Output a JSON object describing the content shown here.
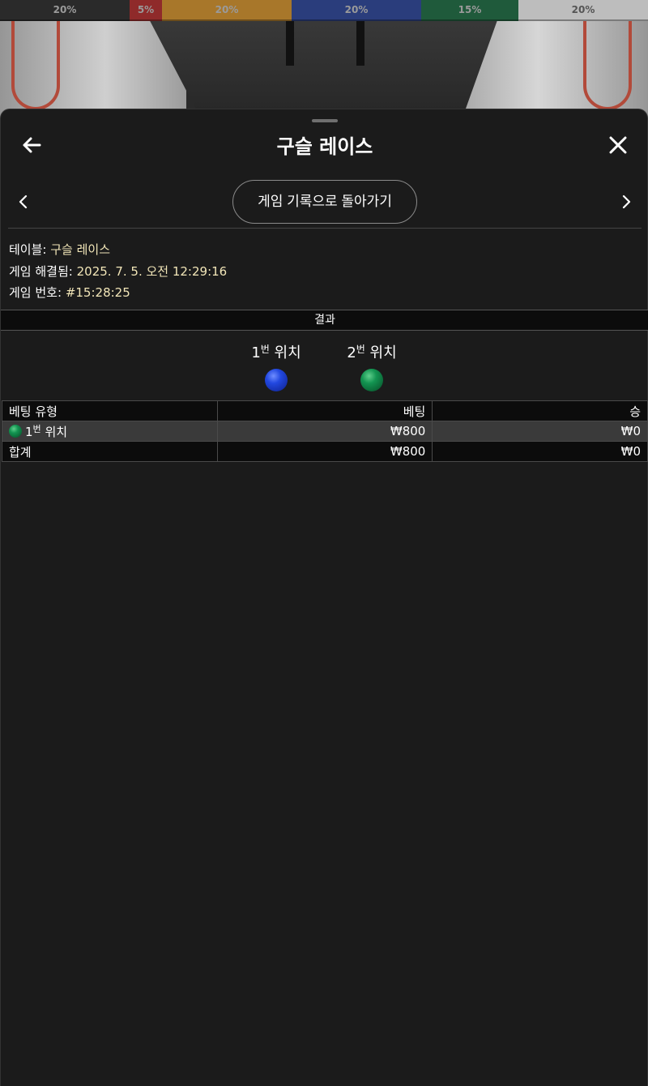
{
  "percent_bar": [
    {
      "label": "20%",
      "color": "#2a2a2a",
      "share": 0.2
    },
    {
      "label": "5%",
      "color": "#8f2a2a",
      "share": 0.05
    },
    {
      "label": "20%",
      "color": "#a8772a",
      "share": 0.2
    },
    {
      "label": "20%",
      "color": "#2a3d7c",
      "share": 0.2
    },
    {
      "label": "15%",
      "color": "#1f5a3b",
      "share": 0.15
    },
    {
      "label": "20%",
      "color": "#bdbdbd",
      "share": 0.2
    }
  ],
  "header": {
    "title": "구슬 레이스",
    "back_icon": "arrow-left-icon",
    "close_icon": "close-icon"
  },
  "nav": {
    "history_label": "게임 기록으로 돌아가기",
    "prev_icon": "chevron-left-icon",
    "next_icon": "chevron-right-icon"
  },
  "info": {
    "table_label": "테이블:",
    "table_value": "구슬 레이스",
    "resolved_label": "게임 해결됨:",
    "resolved_value": "2025. 7. 5. 오전 12:29:16",
    "number_label": "게임 번호:",
    "number_value": "#15:28:25"
  },
  "results": {
    "header": "결과",
    "positions": [
      {
        "num": "1",
        "sup": "번",
        "label": "위치",
        "ball_color": "blue"
      },
      {
        "num": "2",
        "sup": "번",
        "label": "위치",
        "ball_color": "green"
      }
    ]
  },
  "bets_table": {
    "columns": [
      "베팅 유형",
      "베팅",
      "승"
    ],
    "rows": [
      {
        "num": "1",
        "sup": "번",
        "label": "위치",
        "ball_color": "green",
        "bet": "₩800",
        "win": "₩0"
      }
    ],
    "total": {
      "label": "합계",
      "bet": "₩800",
      "win": "₩0"
    }
  },
  "colors": {
    "background": "#1b1b1b",
    "value_text": "#f2e6b8",
    "header_bg": "#0c0c0c",
    "selected_row_bg": "#3a3a3a"
  }
}
